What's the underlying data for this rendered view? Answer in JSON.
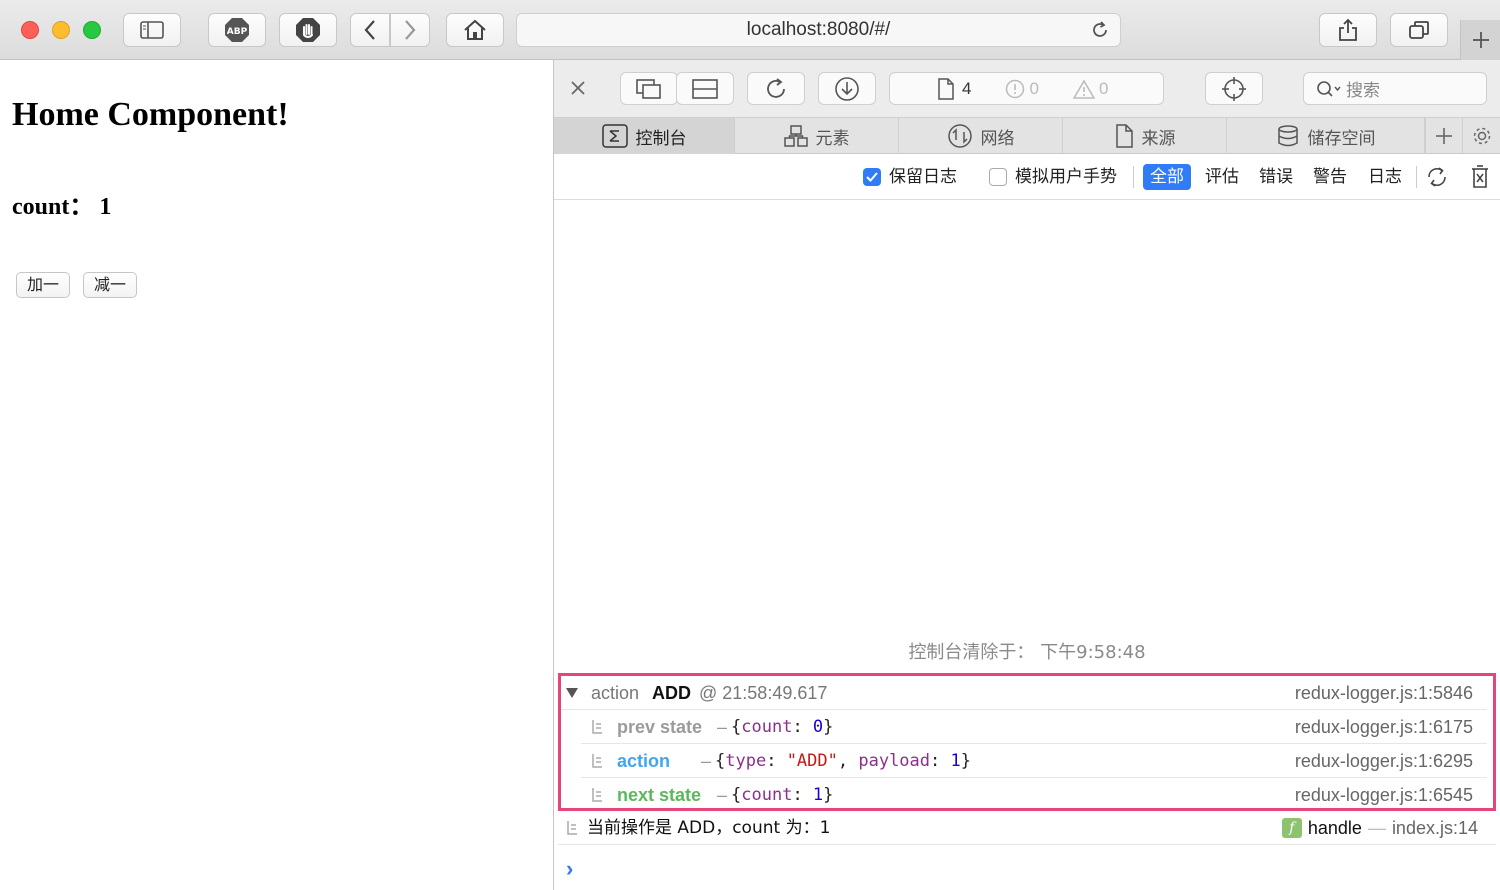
{
  "browser": {
    "url": "localhost:8080/#/"
  },
  "page": {
    "heading": "Home Component!",
    "count_text": "count：  1",
    "buttons": {
      "add": "加一",
      "subtract": "减一"
    }
  },
  "devtools": {
    "resource_count": "4",
    "error_count": "0",
    "warning_count": "0",
    "search_placeholder": "搜索",
    "tabs": [
      "控制台",
      "元素",
      "网络",
      "来源",
      "储存空间"
    ],
    "filters": {
      "preserve_log": "保留日志",
      "simulate_gesture": "模拟用户手势",
      "levels": [
        "全部",
        "评估",
        "错误",
        "警告",
        "日志"
      ]
    },
    "console": {
      "cleared_message": "控制台清除于：  下午9:58:48",
      "group": {
        "prefix": "action",
        "action": "ADD",
        "time": "@ 21:58:49.617",
        "source": "redux-logger.js:1:5846"
      },
      "rows": [
        {
          "label": "prev state",
          "dash": "–",
          "v1": "{",
          "key": "count",
          "colon": ": ",
          "val": "0",
          "close": "}",
          "source": "redux-logger.js:1:6175"
        },
        {
          "label": "action",
          "dash": "–",
          "v1": "{",
          "key": "type",
          "colon": ": ",
          "val": "\"ADD\"",
          "sep": ", ",
          "key2": "payload",
          "colon2": ": ",
          "val2": "1",
          "close": "}",
          "source": "redux-logger.js:1:6295"
        },
        {
          "label": "next state",
          "dash": "–",
          "v1": "{",
          "key": "count",
          "colon": ": ",
          "val": "1",
          "close": "}",
          "source": "redux-logger.js:1:6545"
        }
      ],
      "log_line": {
        "text": "当前操作是 ADD，count 为：1",
        "func": "handle",
        "dash": "—",
        "source": "index.js:14"
      },
      "prompt": "›"
    }
  },
  "colors": {
    "highlight_border": "#e4457a",
    "prev_state": "#9b9b9b",
    "action": "#3fa6f0",
    "next_state": "#5cb85c",
    "accent": "#2f7cf6"
  }
}
